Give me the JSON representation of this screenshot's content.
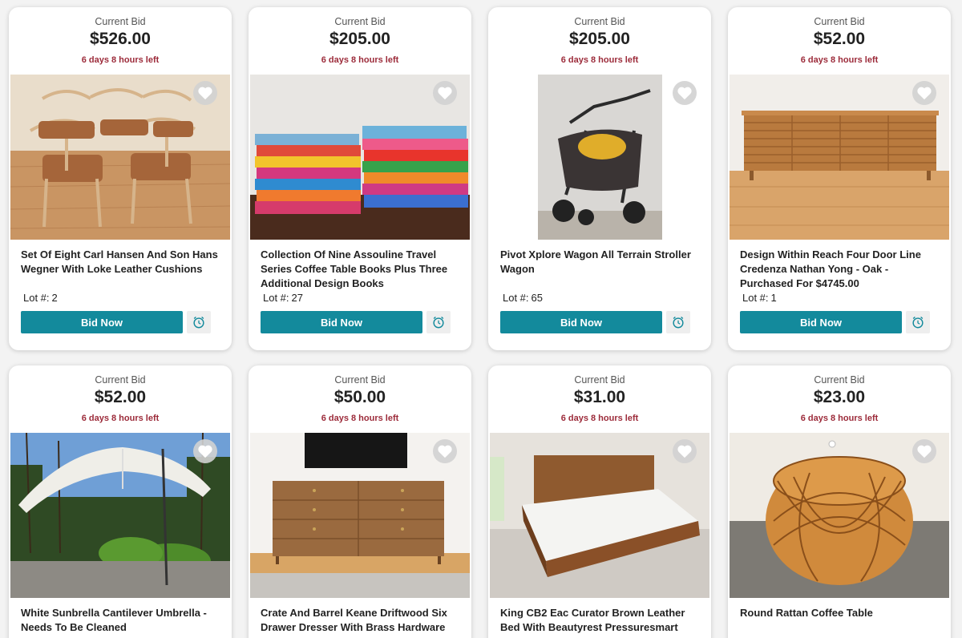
{
  "labels": {
    "current_bid": "Current Bid",
    "bid_now": "Bid Now",
    "lot_prefix": "Lot #:"
  },
  "colors": {
    "accent": "#138a9c",
    "time_red": "#9c2b3a"
  },
  "items": [
    {
      "price": "$526.00",
      "time_left": "6 days 8 hours left",
      "title": "Set Of Eight Carl Hansen And Son Hans Wegner With Loke Leather Cushions",
      "lot": "2"
    },
    {
      "price": "$205.00",
      "time_left": "6 days 8 hours left",
      "title": "Collection Of Nine Assouline Travel Series Coffee Table Books Plus Three Additional Design Books",
      "lot": "27"
    },
    {
      "price": "$205.00",
      "time_left": "6 days 8 hours left",
      "title": "Pivot Xplore Wagon All Terrain Stroller Wagon",
      "lot": "65"
    },
    {
      "price": "$52.00",
      "time_left": "6 days 8 hours left",
      "title": "Design Within Reach Four Door Line Credenza Nathan Yong - Oak - Purchased For $4745.00",
      "lot": "1"
    },
    {
      "price": "$52.00",
      "time_left": "6 days 8 hours left",
      "title": "White Sunbrella Cantilever Umbrella - Needs To Be Cleaned"
    },
    {
      "price": "$50.00",
      "time_left": "6 days 8 hours left",
      "title": "Crate And Barrel Keane Driftwood Six Drawer Dresser With Brass Hardware"
    },
    {
      "price": "$31.00",
      "time_left": "6 days 8 hours left",
      "title": "King CB2 Eac Curator Brown Leather Bed With Beautyrest Pressuresmart"
    },
    {
      "price": "$23.00",
      "time_left": "6 days 8 hours left",
      "title": "Round Rattan Coffee Table"
    }
  ]
}
